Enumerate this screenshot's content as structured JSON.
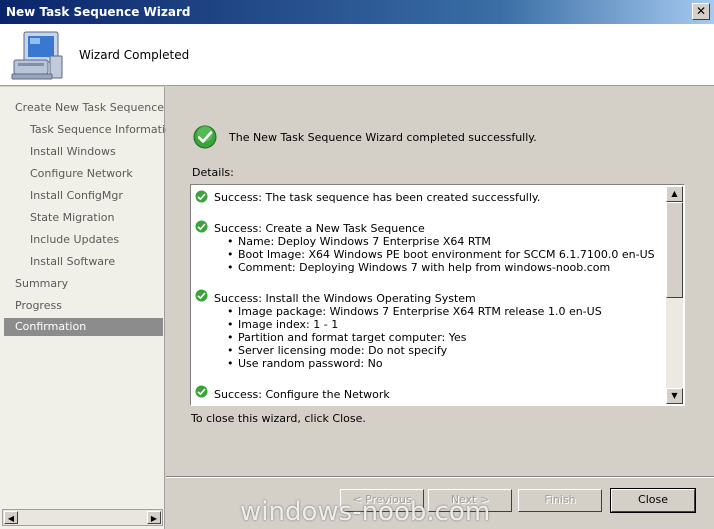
{
  "window": {
    "title": "New Task Sequence Wizard",
    "close_glyph": "✕"
  },
  "header": {
    "title": "Wizard Completed"
  },
  "sidebar": {
    "items": [
      {
        "label": "Create New Task Sequence"
      },
      {
        "label": "Task Sequence Information"
      },
      {
        "label": "Install Windows"
      },
      {
        "label": "Configure Network"
      },
      {
        "label": "Install ConfigMgr"
      },
      {
        "label": "State Migration"
      },
      {
        "label": "Include Updates"
      },
      {
        "label": "Install Software"
      },
      {
        "label": "Summary"
      },
      {
        "label": "Progress"
      },
      {
        "label": "Confirmation"
      }
    ]
  },
  "main": {
    "success_message": "The New Task Sequence Wizard completed successfully.",
    "details_label": "Details:",
    "details": [
      {
        "title": "Success: The task sequence has been created successfully.",
        "lines": []
      },
      {
        "title": "Success: Create a New Task Sequence",
        "lines": [
          "Name: Deploy Windows 7 Enterprise X64 RTM",
          "Boot Image: X64 Windows PE boot environment for SCCM 6.1.7100.0 en-US",
          "Comment: Deploying Windows 7 with help from windows-noob.com"
        ]
      },
      {
        "title": "Success: Install the Windows Operating System",
        "lines": [
          "Image package: Windows 7 Enterprise X64 RTM release 1.0 en-US",
          "Image index: 1 - 1",
          "Partition and format target computer: Yes",
          "Server licensing mode: Do not specify",
          "Use random password: No"
        ]
      },
      {
        "title": "Success: Configure the Network",
        "lines": []
      }
    ],
    "close_hint": "To close this wizard, click Close."
  },
  "buttons": {
    "previous": "< Previous",
    "next": "Next >",
    "finish": "Finish",
    "close": "Close"
  },
  "watermark": "windows-noob.com",
  "colors": {
    "titlebar_start": "#0a246a",
    "success_green": "#3aa33a",
    "active_nav": "#8c8c8c"
  }
}
